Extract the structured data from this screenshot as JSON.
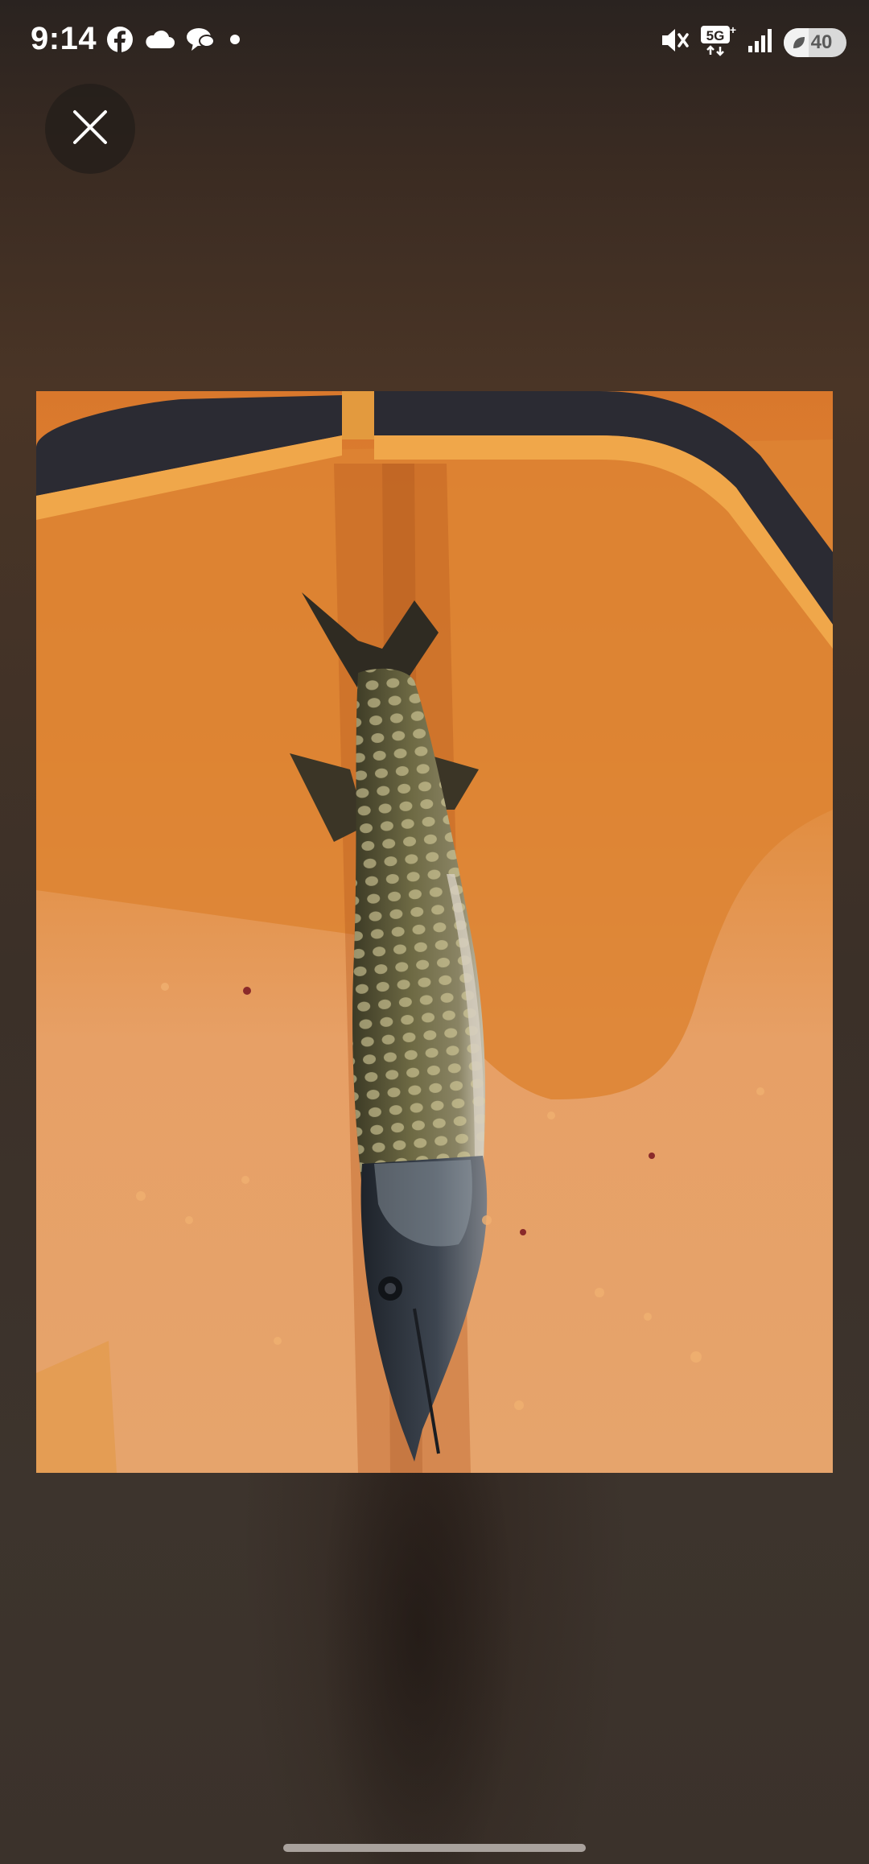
{
  "status_bar": {
    "time": "9:14",
    "notification_icons": [
      "facebook-icon",
      "cloud-icon",
      "chat-bubbles-icon",
      "dot-icon"
    ],
    "system_icons": [
      "mute-icon",
      "5g-icon",
      "signal-icon"
    ],
    "network_label": "5G",
    "battery_level": "40",
    "battery_fraction": 0.4
  },
  "viewer": {
    "close_icon": "close-icon",
    "photo_subject": "fish-photo",
    "colors": {
      "background": "#3a2e27",
      "tray": "#e9a060",
      "rim": "#2b2b33"
    }
  }
}
